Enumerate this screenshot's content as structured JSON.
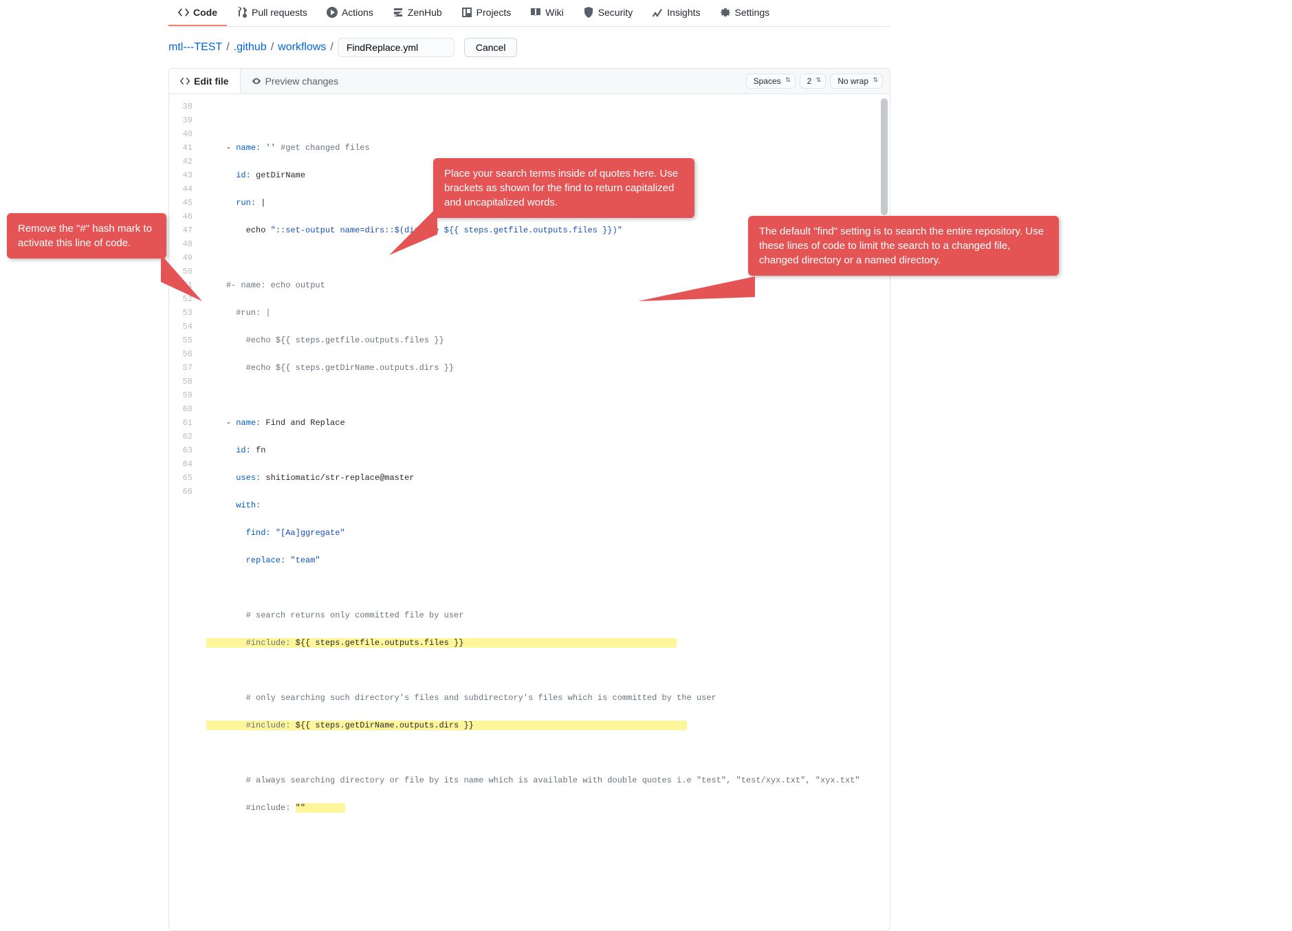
{
  "nav": {
    "code": "Code",
    "pr": "Pull requests",
    "actions": "Actions",
    "zenhub": "ZenHub",
    "projects": "Projects",
    "wiki": "Wiki",
    "security": "Security",
    "insights": "Insights",
    "settings": "Settings"
  },
  "breadcrumb": {
    "repo": "mtl---TEST",
    "p1": ".github",
    "p2": "workflows",
    "filename": "FindReplace.yml",
    "cancel": "Cancel"
  },
  "editor": {
    "tab_edit": "Edit file",
    "tab_preview": "Preview changes",
    "indent_mode": "Spaces",
    "indent_size": "2",
    "wrap_mode": "No wrap"
  },
  "lines": {
    "start": 38,
    "end": 66,
    "l39": "    - name: '' #get changed files",
    "l40": "      id: getDirName",
    "l41": "      run: |",
    "l42": "        echo \"::set-output name=dirs::$(dirname ${{ steps.getfile.outputs.files }})\"",
    "l44": "    #- name: echo output",
    "l45": "      #run: |",
    "l46": "        #echo ${{ steps.getfile.outputs.files }}",
    "l47": "        #echo ${{ steps.getDirName.outputs.dirs }}",
    "l49": "    - name: Find and Replace",
    "l50": "      id: fn",
    "l51": "      uses: shitiomatic/str-replace@master",
    "l52": "      with:",
    "l53": "        find: \"[Aa]ggregate\"",
    "l54": "        replace: \"team\"",
    "l56": "        # search returns only committed file by user",
    "l57_a": "        #include: ",
    "l57_b": "${{ steps.getfile.outputs.files }}",
    "l59": "        # only searching such directory's files and subdirectory's files which is committed by the user",
    "l60_a": "        #include: ",
    "l60_b": "${{ steps.getDirName.outputs.dirs }}",
    "l62": "        # always searching directory or file by its name which is available with double quotes i.e \"test\", \"test/xyx.txt\", \"xyx.txt\"",
    "l63_a": "        #include: ",
    "l63_b": "\"\""
  },
  "callouts": {
    "left": "Remove the \"#\" hash mark to activate this line of code.",
    "top": "Place your search terms inside of quotes here.  Use brackets as shown for the find to return capitalized and uncapitalized words.",
    "right": "The default \"find\" setting is to search the entire repository.  Use these lines of code to limit the search to a changed file, changed directory or a named directory."
  }
}
